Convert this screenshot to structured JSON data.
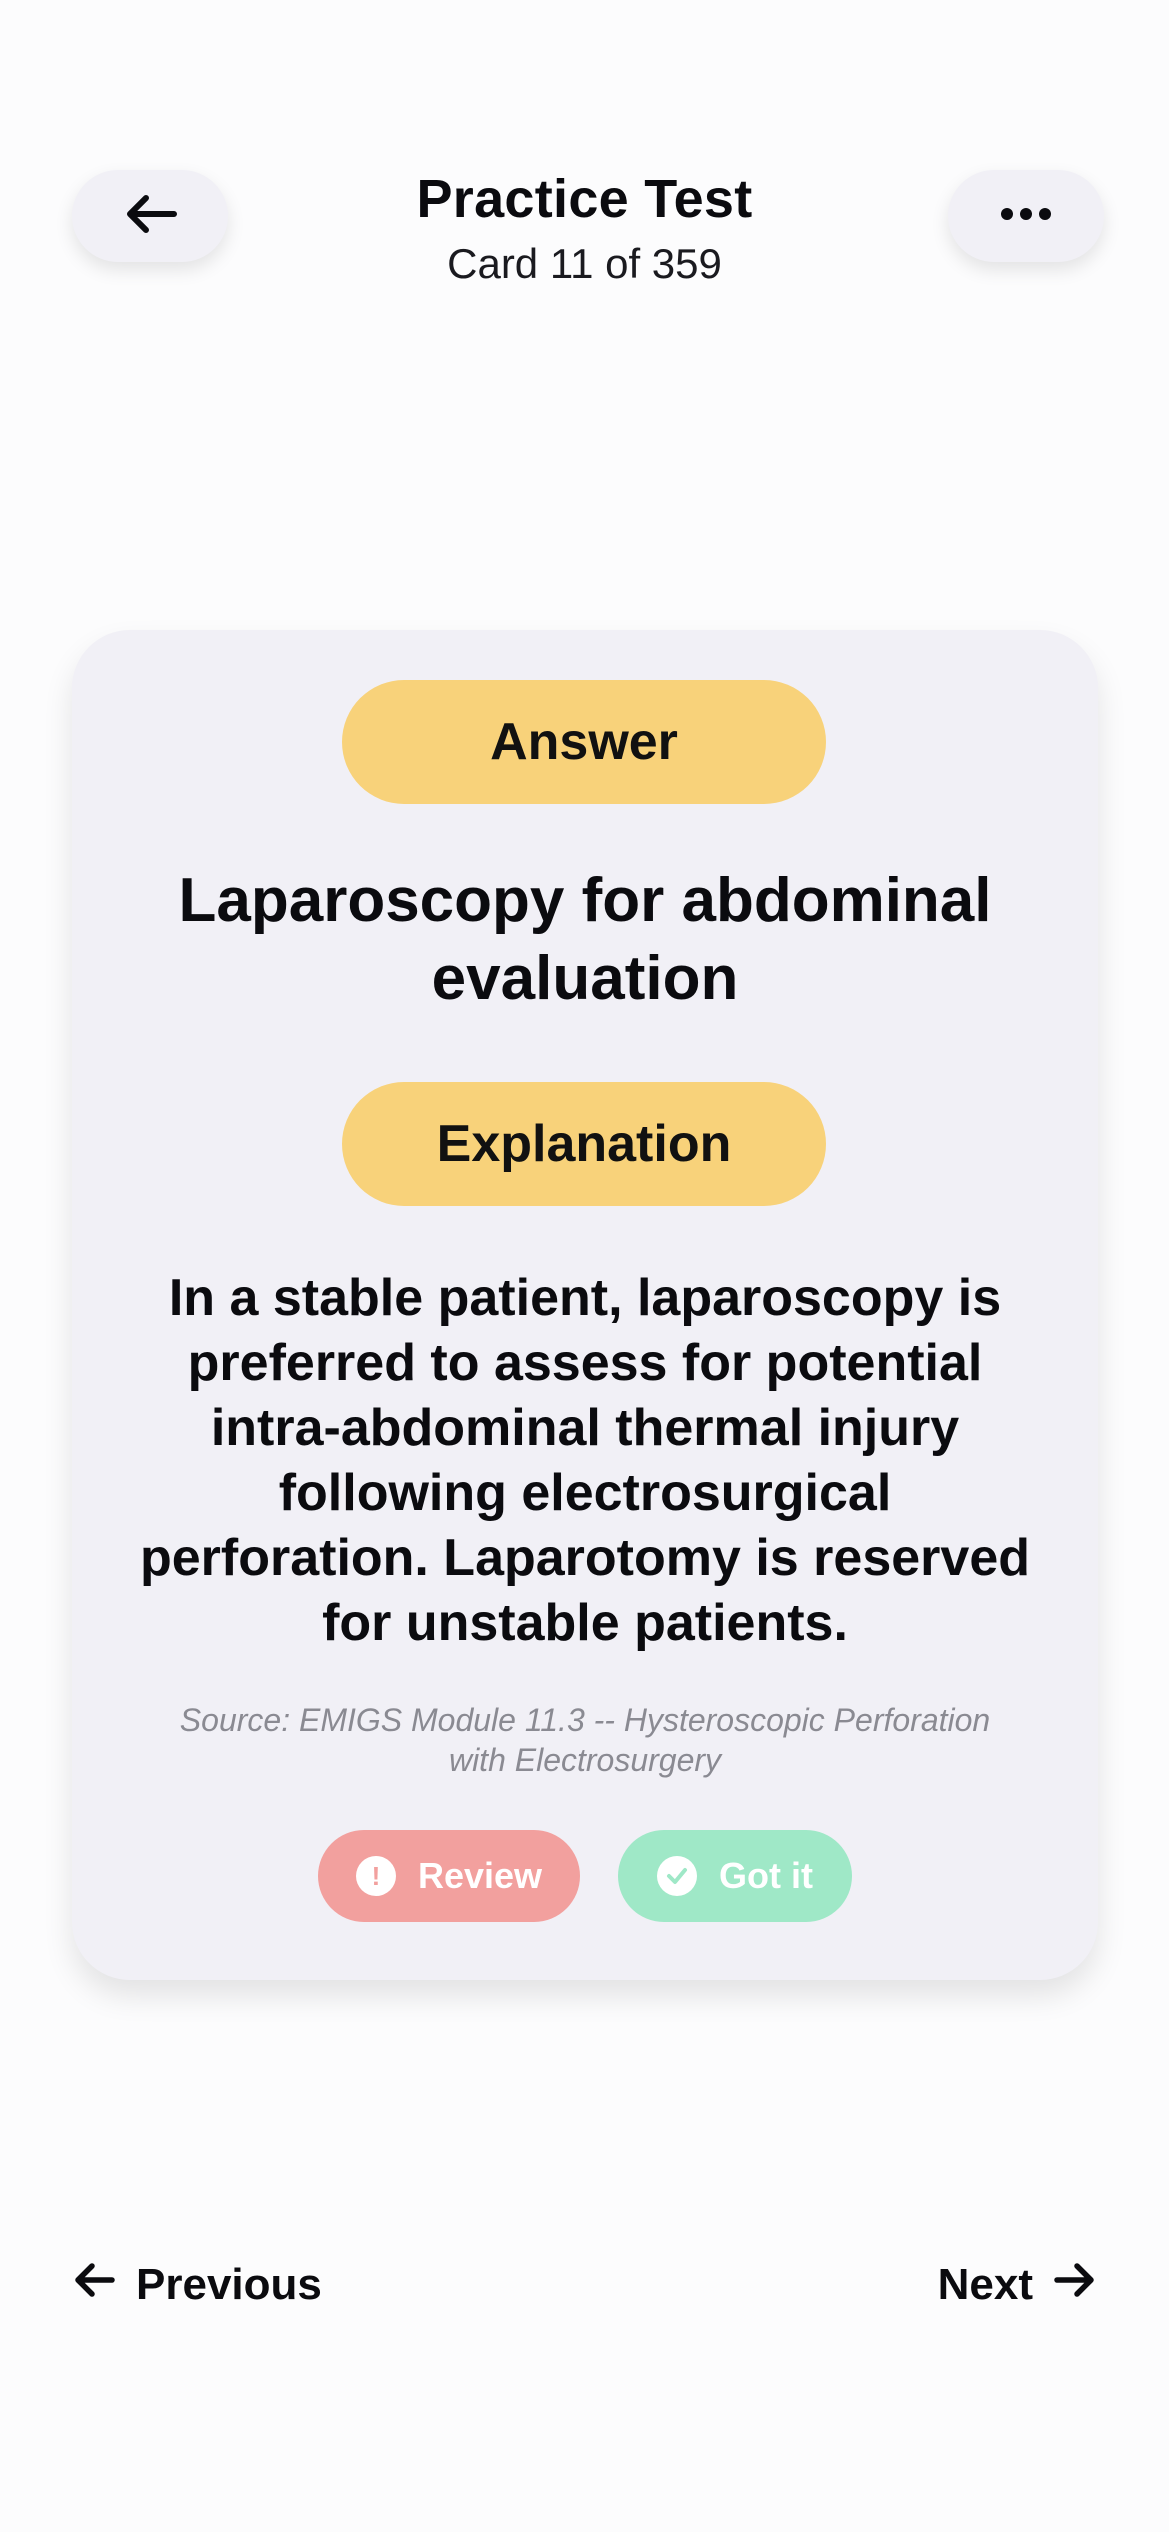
{
  "header": {
    "title": "Practice Test",
    "subtitle": "Card 11 of 359",
    "back_icon": "arrow-left-icon",
    "more_icon": "ellipsis-icon"
  },
  "card": {
    "answer_label": "Answer",
    "answer_text": "Laparoscopy for abdominal evaluation",
    "explanation_label": "Explanation",
    "explanation_text": "In a stable patient, laparoscopy is preferred to assess for potential intra-abdominal thermal injury following electrosurgical perforation. Laparotomy is reserved for unstable patients.",
    "source_text": "Source: EMIGS Module 11.3 -- Hysteroscopic Perforation with Electrosurgery",
    "review_label": "Review",
    "gotit_label": "Got it"
  },
  "navigation": {
    "previous_label": "Previous",
    "next_label": "Next"
  },
  "colors": {
    "pill": "#f8d27a",
    "review": "#f2a09e",
    "gotit": "#9fe8c7",
    "card_bg": "#f1f0f6"
  }
}
